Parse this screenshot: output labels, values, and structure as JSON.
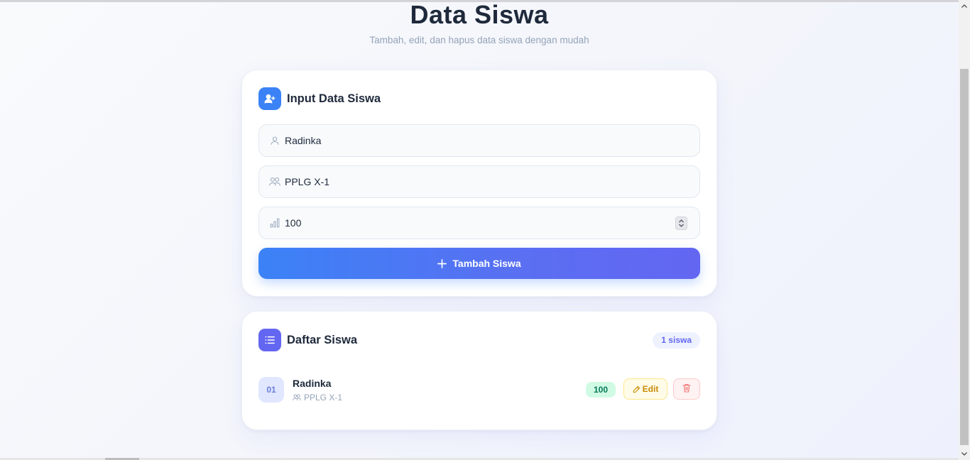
{
  "header": {
    "title": "Data Siswa",
    "subtitle": "Tambah, edit, dan hapus data siswa dengan mudah"
  },
  "input_card": {
    "title": "Input Data Siswa",
    "icon": "user-plus-icon",
    "fields": {
      "name": {
        "value": "Radinka",
        "icon": "user-icon"
      },
      "class": {
        "value": "PPLG X-1",
        "icon": "users-icon"
      },
      "score": {
        "value": "100",
        "icon": "bar-chart-icon"
      }
    },
    "add_button_label": "Tambah Siswa"
  },
  "list_card": {
    "title": "Daftar Siswa",
    "icon": "list-icon",
    "count_badge": "1 siswa",
    "students": [
      {
        "number": "01",
        "name": "Radinka",
        "class": "PPLG X-1",
        "score": "100",
        "edit_label": "Edit"
      }
    ]
  },
  "colors": {
    "primary_blue": "#3b82f6",
    "indigo": "#6366f1",
    "score_green": "#047857",
    "edit_yellow": "#ca8a04",
    "delete_red": "#ef4444"
  }
}
